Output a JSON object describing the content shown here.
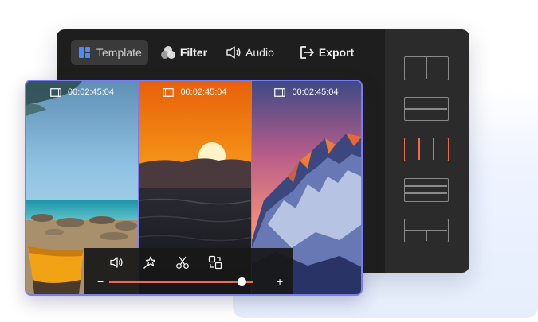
{
  "toolbar": {
    "template_label": "Template",
    "filter_label": "Filter",
    "audio_label": "Audio",
    "export_label": "Export"
  },
  "clips": [
    {
      "timecode": "00:02:45:04"
    },
    {
      "timecode": "00:02:45:04"
    },
    {
      "timecode": "00:02:45:04"
    }
  ],
  "layouts": [
    "two-columns",
    "two-rows",
    "three-columns",
    "three-rows",
    "four-grid"
  ],
  "selected_layout": "three-columns",
  "controls": {
    "icons": [
      "volume-icon",
      "magic-icon",
      "scissors-icon",
      "swap-icon"
    ],
    "minus": "−",
    "plus": "+",
    "zoom_level": 0.92
  },
  "colors": {
    "accent": "#ef6a4a",
    "selection_border": "#7b7cf0",
    "active_tab_icon": "#4a8ef5"
  }
}
